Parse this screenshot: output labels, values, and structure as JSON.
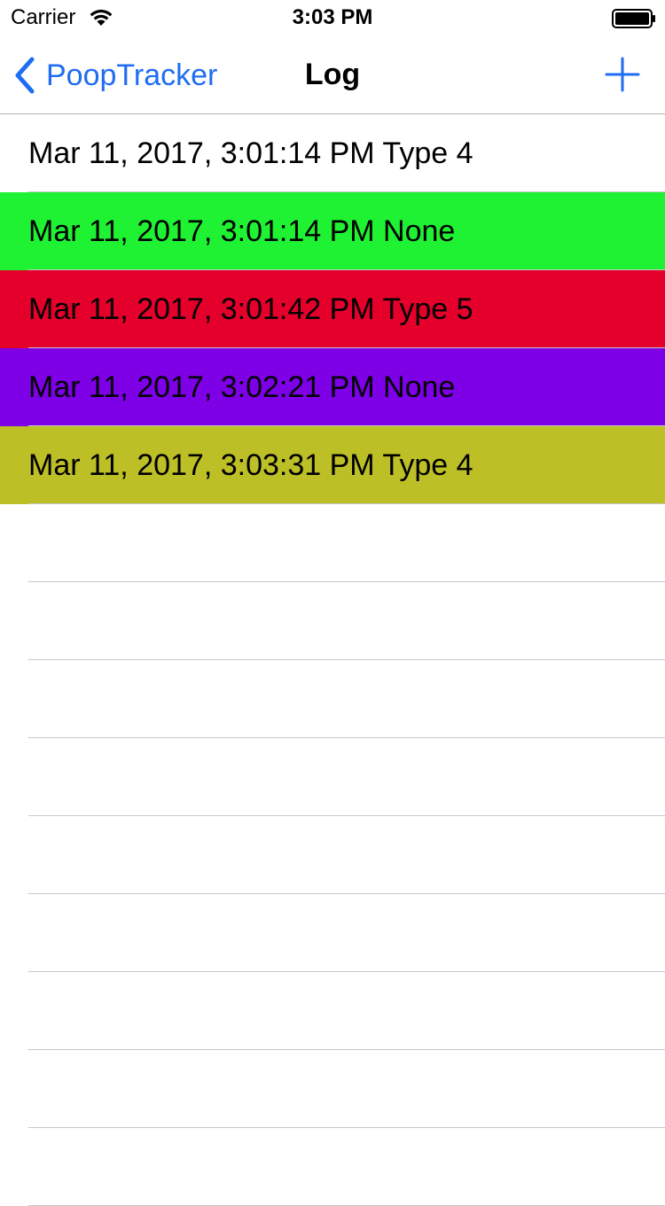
{
  "status_bar": {
    "carrier": "Carrier",
    "time": "3:03 PM",
    "icons": [
      "wifi-icon",
      "battery-icon"
    ]
  },
  "nav": {
    "back_label": "PoopTracker",
    "title": "Log",
    "tint_color": "#1f6df2",
    "icons": [
      "chevron-left-icon",
      "plus-icon"
    ]
  },
  "log_entries": [
    {
      "text": "Mar 11, 2017, 3:01:14 PM Type 4",
      "color": "#ffffff"
    },
    {
      "text": "Mar 11, 2017, 3:01:14 PM None",
      "color": "#1ff232"
    },
    {
      "text": "Mar 11, 2017, 3:01:42 PM Type 5",
      "color": "#e4002b"
    },
    {
      "text": "Mar 11, 2017, 3:02:21 PM None",
      "color": "#7d00e6"
    },
    {
      "text": "Mar 11, 2017, 3:03:31 PM Type 4",
      "color": "#bdbf27"
    },
    {
      "text": "",
      "color": "#ffffff"
    },
    {
      "text": "",
      "color": "#ffffff"
    },
    {
      "text": "",
      "color": "#ffffff"
    },
    {
      "text": "",
      "color": "#ffffff"
    },
    {
      "text": "",
      "color": "#ffffff"
    },
    {
      "text": "",
      "color": "#ffffff"
    },
    {
      "text": "",
      "color": "#ffffff"
    },
    {
      "text": "",
      "color": "#ffffff"
    },
    {
      "text": "",
      "color": "#ffffff"
    }
  ]
}
